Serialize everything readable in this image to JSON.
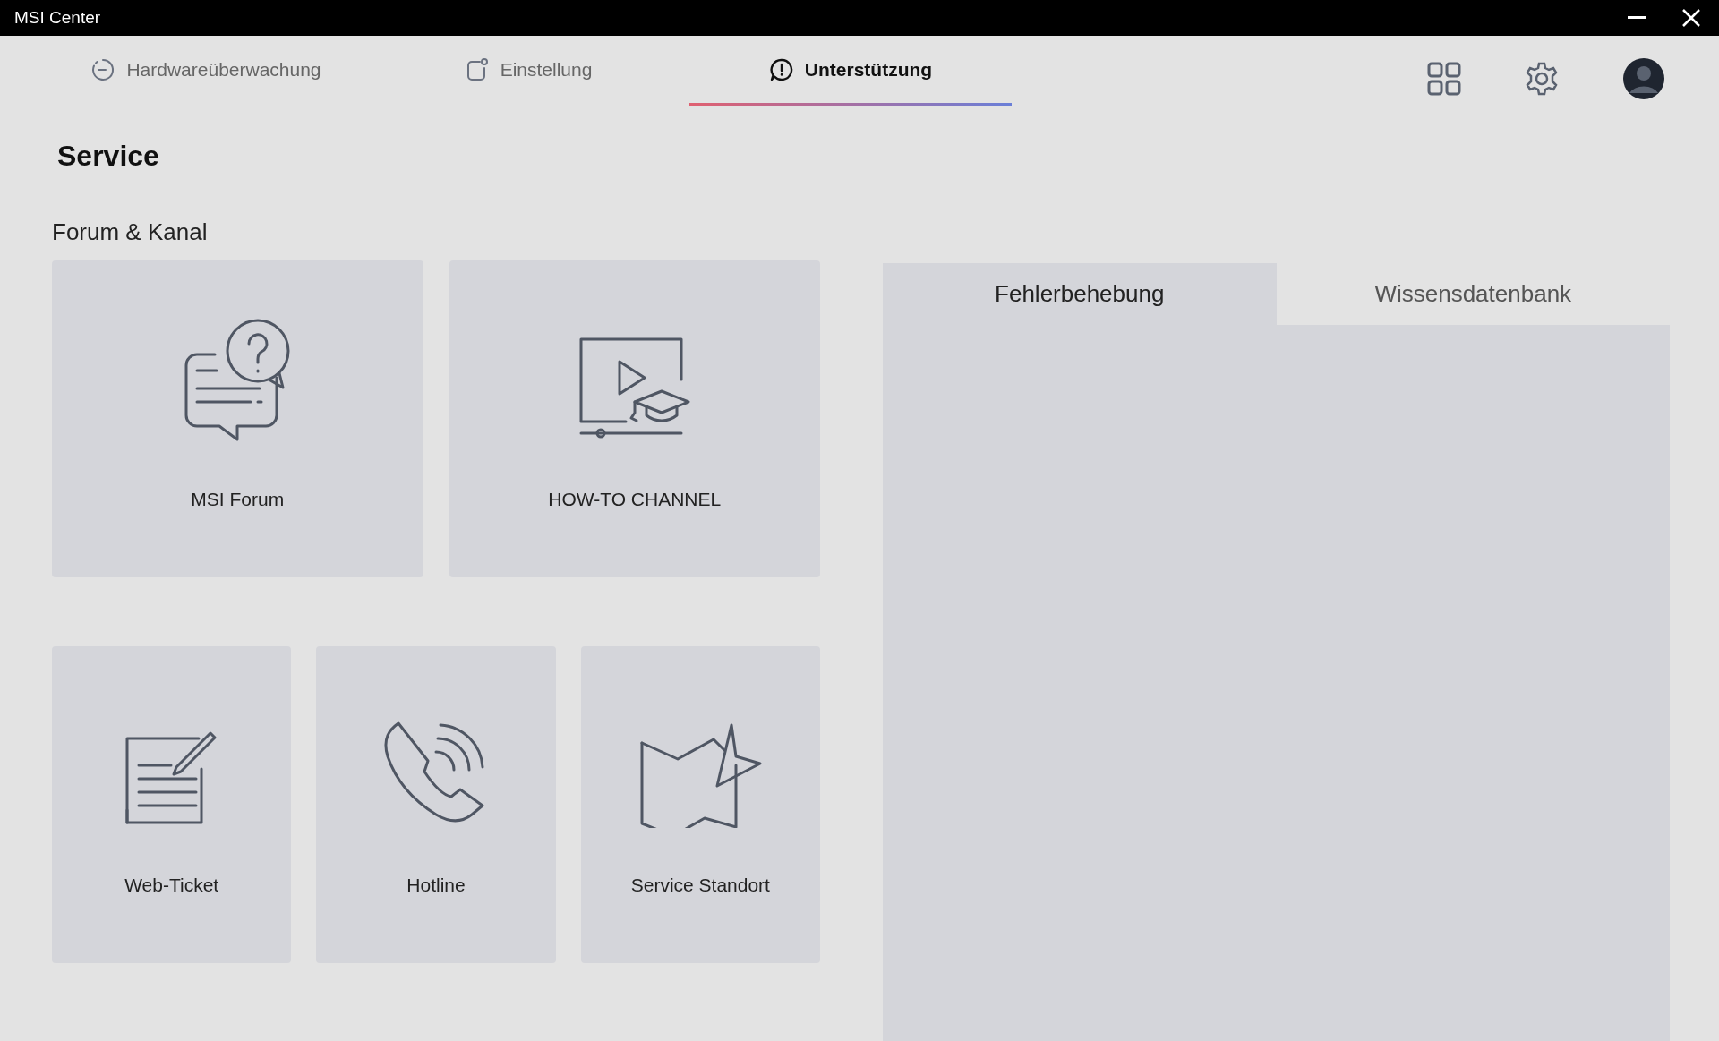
{
  "window": {
    "title": "MSI Center"
  },
  "tabs": [
    {
      "label": "Hardwareüberwachung",
      "selected": false
    },
    {
      "label": "Einstellung",
      "selected": false
    },
    {
      "label": "Unterstützung",
      "selected": true
    }
  ],
  "page": {
    "title": "Service"
  },
  "forum": {
    "heading": "Forum & Kanal",
    "tiles": [
      {
        "label": "MSI Forum"
      },
      {
        "label": "HOW-TO CHANNEL"
      }
    ]
  },
  "service_tiles": [
    {
      "label": "Web-Ticket"
    },
    {
      "label": "Hotline"
    },
    {
      "label": "Service Standort"
    }
  ],
  "panel": {
    "tabs": [
      {
        "label": "Fehlerbehebung",
        "selected": true
      },
      {
        "label": "Wissensdatenbank",
        "selected": false
      }
    ]
  }
}
